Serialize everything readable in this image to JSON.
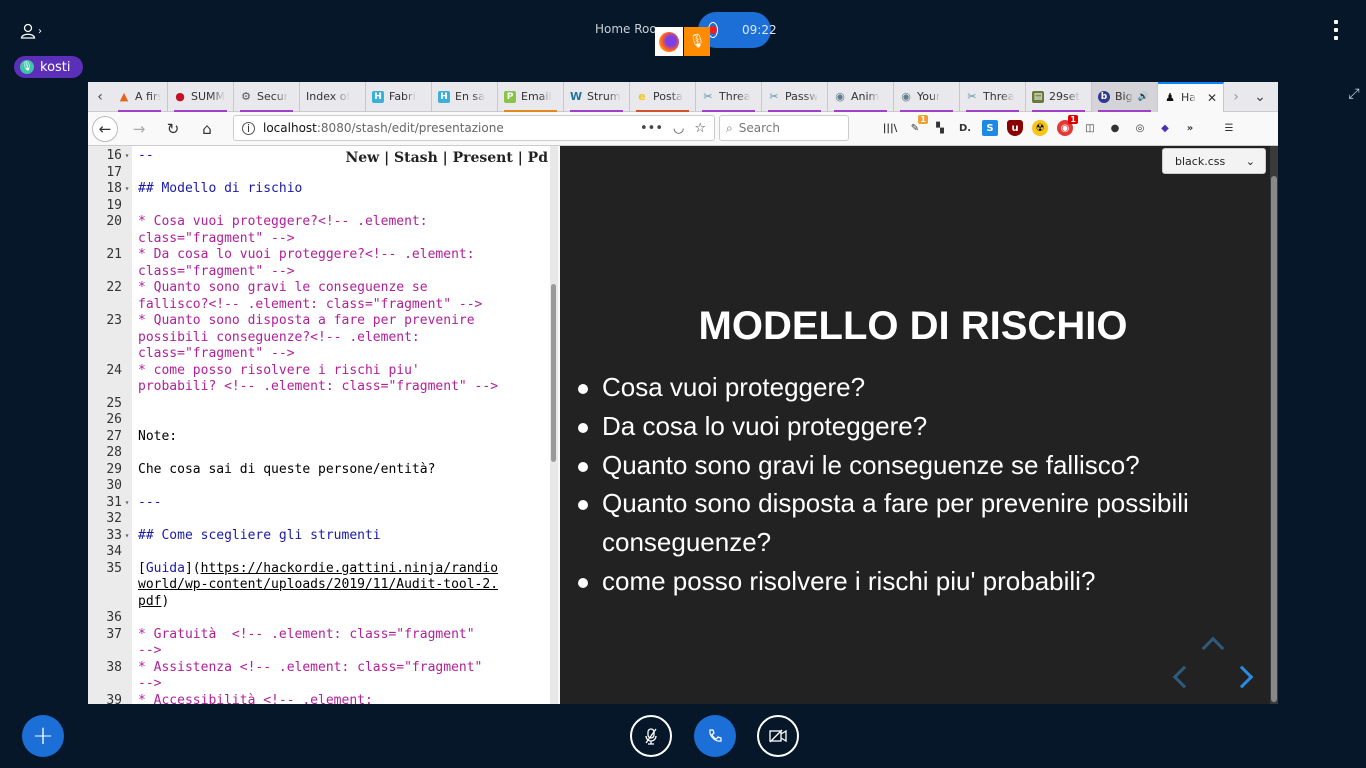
{
  "conference": {
    "room_title": "Home Roo",
    "recording_time": "09:22",
    "user_name": "kosti",
    "icons": {
      "user_list": "user-chevron-icon",
      "menu": "kebab-menu-icon",
      "fullscreen": "fullscreen-icon",
      "add": "plus-icon",
      "mic": "mic-muted-icon",
      "phone": "phone-icon",
      "camera": "camera-off-icon"
    }
  },
  "browser": {
    "tabs": [
      {
        "label": "A firs",
        "icon": "flame-icon",
        "icon_color": "#e8641b"
      },
      {
        "label": "SUMM",
        "icon": "pin-icon",
        "icon_color": "#c0102a"
      },
      {
        "label": "Secur",
        "icon": "gear-check-icon",
        "icon_color": "#555555"
      },
      {
        "label": "Index of",
        "icon": "",
        "icon_color": ""
      },
      {
        "label": "Fabri",
        "icon": "h-icon",
        "icon_color": "#3ab0d8"
      },
      {
        "label": "En sa",
        "icon": "h-icon",
        "icon_color": "#3ab0d8"
      },
      {
        "label": "Email",
        "icon": "p-icon",
        "icon_color": "#8bc34a"
      },
      {
        "label": "Strum",
        "icon": "wordpress-icon",
        "icon_color": "#21759b"
      },
      {
        "label": "Posta",
        "icon": "e-icon",
        "icon_color": "#f5c518"
      },
      {
        "label": "Threa",
        "icon": "tools-icon",
        "icon_color": "#5a8fa8"
      },
      {
        "label": "Passw",
        "icon": "tools-icon",
        "icon_color": "#5a8fa8"
      },
      {
        "label": "Anim",
        "icon": "lock-circle-icon",
        "icon_color": "#607d8b"
      },
      {
        "label": "Your",
        "icon": "lock-circle-icon",
        "icon_color": "#607d8b"
      },
      {
        "label": "Threa",
        "icon": "tools-icon",
        "icon_color": "#5a8fa8"
      },
      {
        "label": "29set",
        "icon": "clipboard-icon",
        "icon_color": "#6a7a3a"
      },
      {
        "label": "Big",
        "icon": "b-icon",
        "icon_color": "#2f3a8c"
      },
      {
        "label": "Ha",
        "icon": "hacker-icon",
        "icon_color": "#111111"
      }
    ],
    "url_host": "localhost",
    "url_rest": ":8080/stash/edit/presentazione",
    "search_placeholder": "Search",
    "badges": {
      "ext1": "1",
      "ext2": "1"
    }
  },
  "editor": {
    "top_links": "New | Stash | Present | Pd",
    "lines": [
      {
        "n": "16",
        "fold": true,
        "style": "head",
        "text": "--"
      },
      {
        "n": "17",
        "fold": false,
        "style": "plain",
        "text": ""
      },
      {
        "n": "18",
        "fold": true,
        "style": "head",
        "text": "## Modello di rischio"
      },
      {
        "n": "19",
        "fold": false,
        "style": "plain",
        "text": ""
      },
      {
        "n": "20",
        "fold": false,
        "style": "list",
        "text": "* Cosa vuoi proteggere?<!-- .element:\nclass=\"fragment\" -->"
      },
      {
        "n": "21",
        "fold": false,
        "style": "list",
        "text": "* Da cosa lo vuoi proteggere?<!-- .element:\nclass=\"fragment\" -->"
      },
      {
        "n": "22",
        "fold": false,
        "style": "list",
        "text": "* Quanto sono gravi le conseguenze se\nfallisco?<!-- .element: class=\"fragment\" -->"
      },
      {
        "n": "23",
        "fold": false,
        "style": "list",
        "text": "* Quanto sono disposta a fare per prevenire\npossibili conseguenze?<!-- .element:\nclass=\"fragment\" -->"
      },
      {
        "n": "24",
        "fold": false,
        "style": "list",
        "text": "* come posso risolvere i rischi piu'\nprobabili? <!-- .element: class=\"fragment\" -->"
      },
      {
        "n": "25",
        "fold": false,
        "style": "plain",
        "text": ""
      },
      {
        "n": "26",
        "fold": false,
        "style": "plain",
        "text": ""
      },
      {
        "n": "27",
        "fold": false,
        "style": "plain",
        "text": "Note:"
      },
      {
        "n": "28",
        "fold": false,
        "style": "plain",
        "text": ""
      },
      {
        "n": "29",
        "fold": false,
        "style": "plain",
        "text": "Che cosa sai di queste persone/entità?"
      },
      {
        "n": "30",
        "fold": false,
        "style": "plain",
        "text": ""
      },
      {
        "n": "31",
        "fold": true,
        "style": "head",
        "text": "---"
      },
      {
        "n": "32",
        "fold": false,
        "style": "plain",
        "text": ""
      },
      {
        "n": "33",
        "fold": true,
        "style": "head",
        "text": "## Come scegliere gli strumenti"
      },
      {
        "n": "34",
        "fold": false,
        "style": "plain",
        "text": ""
      },
      {
        "n": "35",
        "fold": false,
        "style": "link",
        "link_text": "Guida",
        "text": "https://hackordie.gattini.ninja/randio\nworld/wp-content/uploads/2019/11/Audit-tool-2.\npdf"
      },
      {
        "n": "36",
        "fold": false,
        "style": "plain",
        "text": ""
      },
      {
        "n": "37",
        "fold": false,
        "style": "list",
        "text": "* Gratuità  <!-- .element: class=\"fragment\"\n-->"
      },
      {
        "n": "38",
        "fold": false,
        "style": "list",
        "text": "* Assistenza <!-- .element: class=\"fragment\"\n-->"
      },
      {
        "n": "39",
        "fold": false,
        "style": "list",
        "text": "* Accessibilità <!-- .element:"
      }
    ]
  },
  "slide": {
    "theme": "black.css",
    "title": "MODELLO DI RISCHIO",
    "bullets": [
      "Cosa vuoi proteggere?",
      "Da cosa lo vuoi proteggere?",
      "Quanto sono gravi le conseguenze se fallisco?",
      "Quanto sono disposta a fare per prevenire possibili conseguenze?",
      "come posso risolvere i rischi piu' probabili?"
    ]
  }
}
